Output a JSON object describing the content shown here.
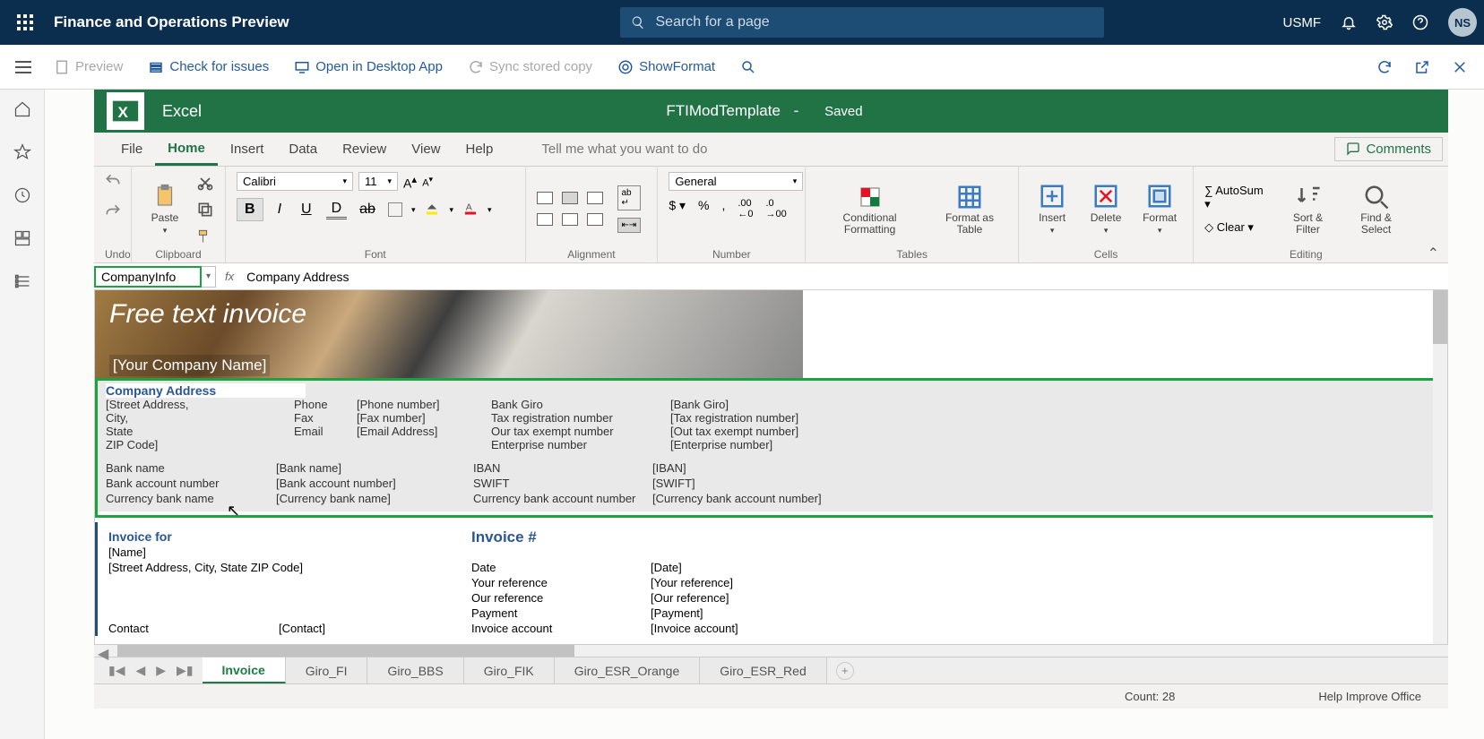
{
  "header": {
    "appTitle": "Finance and Operations Preview",
    "searchPlaceholder": "Search for a page",
    "company": "USMF",
    "userInitials": "NS"
  },
  "toolbar": {
    "preview": "Preview",
    "checkIssues": "Check for issues",
    "openDesktop": "Open in Desktop App",
    "syncStored": "Sync stored copy",
    "showFormat": "ShowFormat"
  },
  "excel": {
    "appName": "Excel",
    "fileName": "FTIModTemplate",
    "saveStatus": "Saved",
    "tabs": [
      "File",
      "Home",
      "Insert",
      "Data",
      "Review",
      "View",
      "Help"
    ],
    "activeTab": "Home",
    "tellMe": "Tell me what you want to do",
    "comments": "Comments",
    "font": {
      "name": "Calibri",
      "size": "11"
    },
    "numberFormat": "General",
    "groups": {
      "undo": "Undo",
      "clipboard": "Clipboard",
      "font": "Font",
      "alignment": "Alignment",
      "number": "Number",
      "tables": "Tables",
      "cells": "Cells",
      "editing": "Editing"
    },
    "buttons": {
      "paste": "Paste",
      "conditionalFormatting": "Conditional Formatting",
      "formatAsTable": "Format as Table",
      "insert": "Insert",
      "delete": "Delete",
      "format": "Format",
      "autoSum": "AutoSum",
      "clear": "Clear",
      "sortFilter": "Sort & Filter",
      "findSelect": "Find & Select"
    },
    "nameBox": "CompanyInfo",
    "formula": "Company Address"
  },
  "template": {
    "heroTitle": "Free text invoice",
    "heroSub": "[Your Company Name]",
    "companyAddress": {
      "heading": "Company Address",
      "addressLines": [
        "[Street Address,",
        "City,",
        "State",
        "ZIP Code]"
      ],
      "contacts": [
        {
          "label": "Phone",
          "value": "[Phone number]"
        },
        {
          "label": "Fax",
          "value": "[Fax number]"
        },
        {
          "label": "Email",
          "value": "[Email Address]"
        }
      ],
      "col3": [
        {
          "label": "Bank Giro",
          "value": "[Bank Giro]"
        },
        {
          "label": "Tax registration number",
          "value": "[Tax registration number]"
        },
        {
          "label": "Our tax exempt number",
          "value": "[Out tax exempt number]"
        },
        {
          "label": "Enterprise number",
          "value": "[Enterprise number]"
        }
      ],
      "bank": [
        {
          "label": "Bank name",
          "value": "[Bank name]",
          "label2": "IBAN",
          "value2": "[IBAN]"
        },
        {
          "label": "Bank account number",
          "value": "[Bank account number]",
          "label2": "SWIFT",
          "value2": "[SWIFT]"
        },
        {
          "label": "Currency bank name",
          "value": "[Currency bank name]",
          "label2": "Currency bank account number",
          "value2": "[Currency bank account number]"
        }
      ]
    },
    "invoiceFor": {
      "heading": "Invoice for",
      "name": "[Name]",
      "address": "[Street Address, City, State ZIP Code]",
      "contactLabel": "Contact",
      "contactValue": "[Contact]"
    },
    "invoiceNum": {
      "heading": "Invoice #",
      "rows": [
        {
          "label": "Date",
          "value": "[Date]"
        },
        {
          "label": "Your reference",
          "value": "[Your reference]"
        },
        {
          "label": "Our reference",
          "value": "[Our reference]"
        },
        {
          "label": "Payment",
          "value": "[Payment]"
        },
        {
          "label": "Invoice account",
          "value": "[Invoice account]"
        }
      ]
    }
  },
  "sheetTabs": {
    "active": "Invoice",
    "tabs": [
      "Invoice",
      "Giro_FI",
      "Giro_BBS",
      "Giro_FIK",
      "Giro_ESR_Orange",
      "Giro_ESR_Red"
    ]
  },
  "statusBar": {
    "count": "Count: 28",
    "help": "Help Improve Office"
  }
}
